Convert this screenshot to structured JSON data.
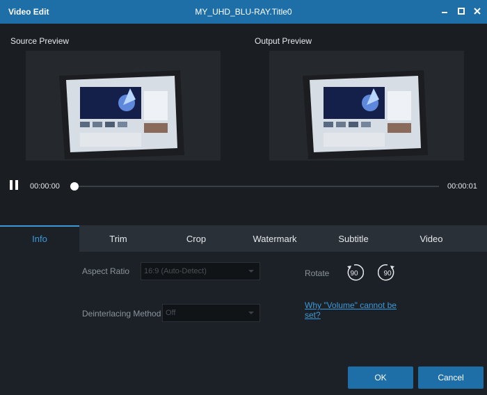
{
  "window": {
    "app_title": "Video Edit",
    "doc_title": "MY_UHD_BLU-RAY.Title0"
  },
  "preview": {
    "source_label": "Source Preview",
    "output_label": "Output Preview"
  },
  "player": {
    "current_time": "00:00:00",
    "total_time": "00:00:01",
    "progress": 0
  },
  "tabs": [
    {
      "label": "Info",
      "active": true
    },
    {
      "label": "Trim",
      "active": false
    },
    {
      "label": "Crop",
      "active": false
    },
    {
      "label": "Watermark",
      "active": false
    },
    {
      "label": "Subtitle",
      "active": false
    },
    {
      "label": "Video",
      "active": false
    }
  ],
  "info": {
    "aspect_ratio_label": "Aspect Ratio",
    "aspect_ratio_value": "16:9 (Auto-Detect)",
    "deinterlacing_label": "Deinterlacing Method",
    "deinterlacing_value": "Off",
    "rotate_label": "Rotate",
    "rotate_left_value": "90",
    "rotate_right_value": "90",
    "volume_link": "Why \"Volume\" cannot be set?"
  },
  "buttons": {
    "ok": "OK",
    "cancel": "Cancel"
  },
  "colors": {
    "accent": "#1e6fa8",
    "active_tab_text": "#3a9ad9",
    "background": "#1c2127"
  }
}
